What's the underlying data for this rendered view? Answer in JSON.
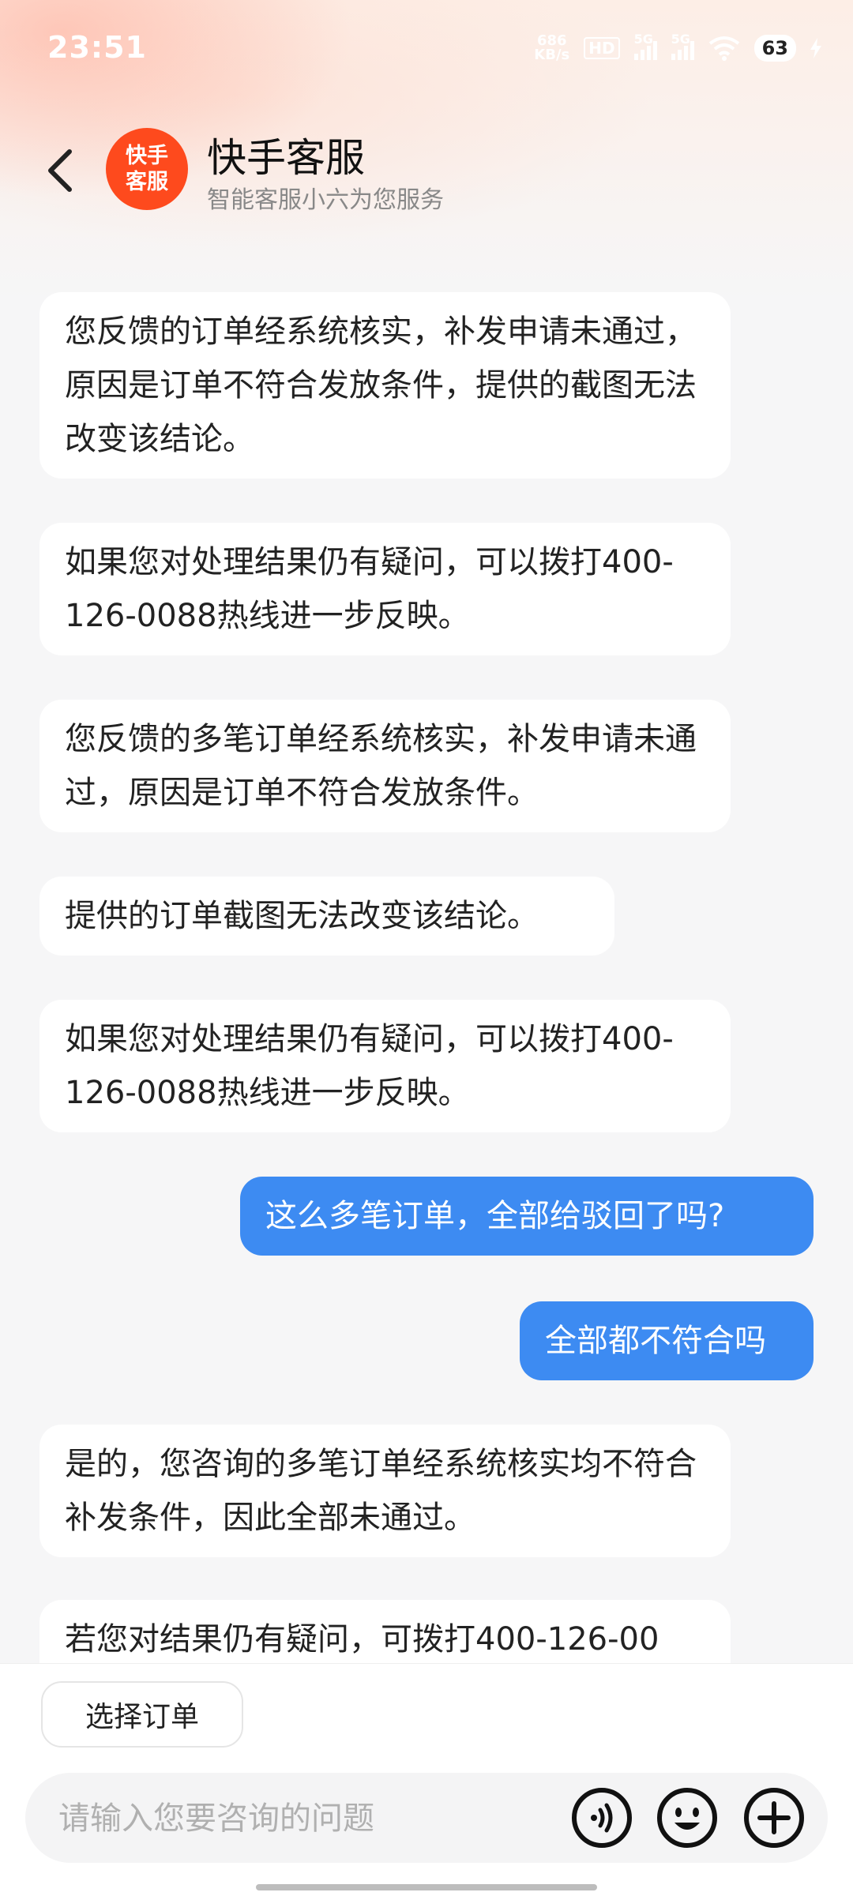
{
  "status_bar": {
    "time": "23:51",
    "net_speed_value": "686",
    "net_speed_unit": "KB/s",
    "hd_badge": "HD",
    "signal1_label": "5G",
    "signal2_label": "5G",
    "battery": "63"
  },
  "header": {
    "avatar_text": "快手客服",
    "title": "快手客服",
    "subtitle": "智能客服小六为您服务"
  },
  "messages": [
    {
      "side": "in",
      "text": "您反馈的订单经系统核实，补发申请未通过，原因是订单不符合发放条件，提供的截图无法改变该结论。"
    },
    {
      "side": "in",
      "text": "如果您对处理结果仍有疑问，可以拨打400-126-0088热线进一步反映。"
    },
    {
      "side": "in",
      "text": "您反馈的多笔订单经系统核实，补发申请未通过，原因是订单不符合发放条件。"
    },
    {
      "side": "in",
      "text": "提供的订单截图无法改变该结论。"
    },
    {
      "side": "in",
      "text": "如果您对处理结果仍有疑问，可以拨打400-126-0088热线进一步反映。"
    },
    {
      "side": "out",
      "text": "这么多笔订单，全部给驳回了吗?"
    },
    {
      "side": "out",
      "text": "全部都不符合吗"
    },
    {
      "side": "in",
      "text": "是的，您咨询的多笔订单经系统核实均不符合补发条件，因此全部未通过。"
    },
    {
      "side": "in",
      "text": "若您对结果仍有疑问，可拨打400-126-00"
    }
  ],
  "quick_actions": {
    "select_order": "选择订单"
  },
  "input": {
    "placeholder": "请输入您要咨询的问题"
  },
  "colors": {
    "accent_blue": "#3d8bf2",
    "avatar_orange": "#fe4a1d"
  }
}
